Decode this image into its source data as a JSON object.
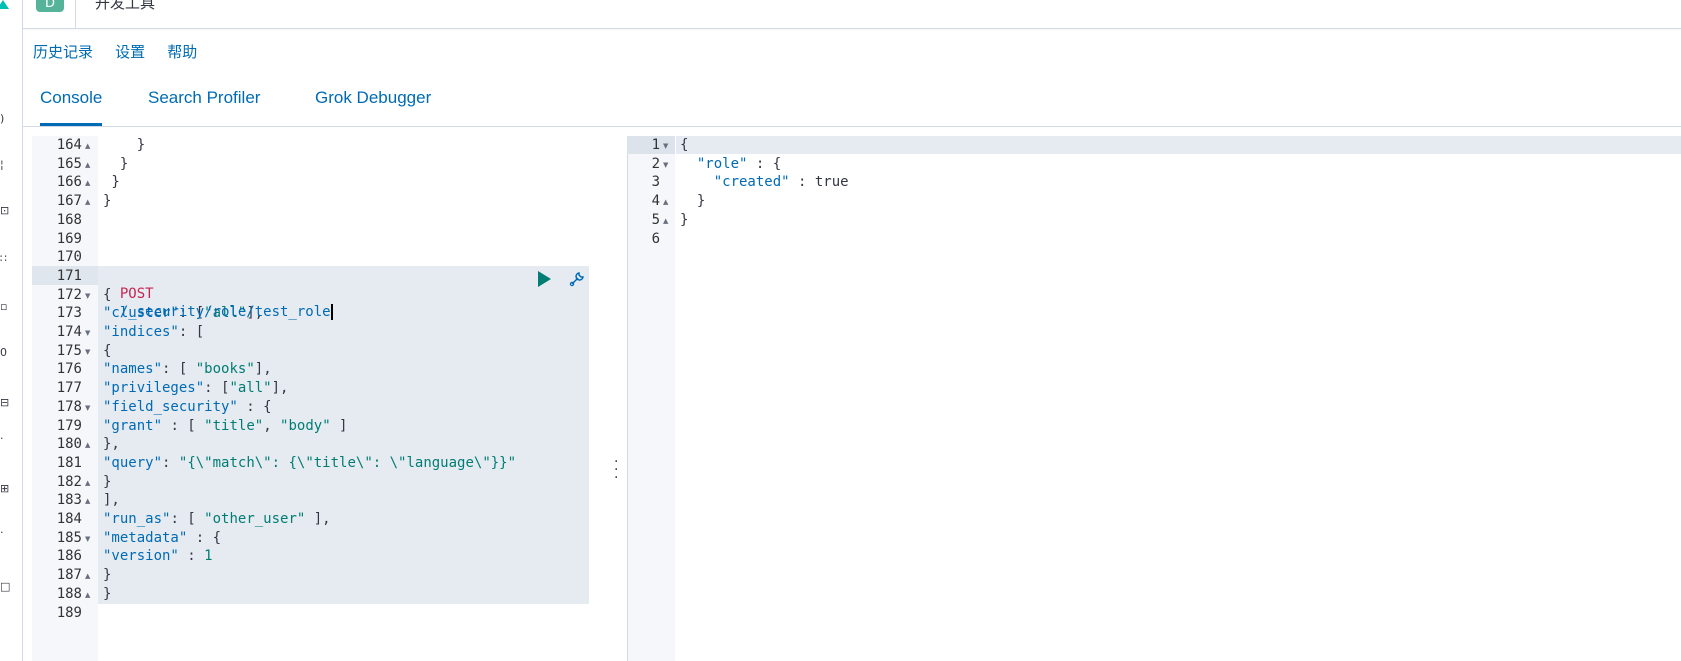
{
  "header": {
    "app_badge": "D",
    "title": "开发工具"
  },
  "menu": {
    "history": "历史记录",
    "settings": "设置",
    "help": "帮助"
  },
  "tabs": [
    {
      "label": "Console",
      "active": true
    },
    {
      "label": "Search Profiler",
      "active": false
    },
    {
      "label": "Grok Debugger",
      "active": false
    }
  ],
  "leftnav": {
    "glyphs": [
      ")",
      "¦",
      "⊡",
      "∷",
      "▫",
      "0",
      "⊟",
      "·",
      "⊞",
      "·",
      "□"
    ]
  },
  "request": {
    "method": "POST",
    "url": "/_security/role/test_role",
    "lines": [
      {
        "n": "164",
        "fold": "up",
        "text": "    }"
      },
      {
        "n": "165",
        "fold": "up",
        "text": "  }"
      },
      {
        "n": "166",
        "fold": "up",
        "text": " }"
      },
      {
        "n": "167",
        "fold": "up",
        "text": "}"
      },
      {
        "n": "168",
        "fold": "",
        "text": ""
      },
      {
        "n": "169",
        "fold": "",
        "text": ""
      },
      {
        "n": "170",
        "fold": "",
        "text": ""
      },
      {
        "n": "171",
        "fold": "",
        "text": ""
      },
      {
        "n": "172",
        "fold": "down",
        "text": "{"
      },
      {
        "n": "173",
        "fold": "",
        "text": "\"cluster\": [\"all\"],"
      },
      {
        "n": "174",
        "fold": "down",
        "text": "\"indices\": ["
      },
      {
        "n": "175",
        "fold": "down",
        "text": "{"
      },
      {
        "n": "176",
        "fold": "",
        "text": "\"names\": [ \"books\"],"
      },
      {
        "n": "177",
        "fold": "",
        "text": "\"privileges\": [\"all\"],"
      },
      {
        "n": "178",
        "fold": "down",
        "text": "\"field_security\" : {"
      },
      {
        "n": "179",
        "fold": "",
        "text": "\"grant\" : [ \"title\", \"body\" ]"
      },
      {
        "n": "180",
        "fold": "up",
        "text": "},"
      },
      {
        "n": "181",
        "fold": "",
        "text": "\"query\": \"{\\\"match\\\": {\\\"title\\\": \\\"language\\\"}}\""
      },
      {
        "n": "182",
        "fold": "up",
        "text": "}"
      },
      {
        "n": "183",
        "fold": "up",
        "text": "],"
      },
      {
        "n": "184",
        "fold": "",
        "text": "\"run_as\": [ \"other_user\" ],"
      },
      {
        "n": "185",
        "fold": "down",
        "text": "\"metadata\" : {"
      },
      {
        "n": "186",
        "fold": "",
        "text": "\"version\" : 1"
      },
      {
        "n": "187",
        "fold": "up",
        "text": "}"
      },
      {
        "n": "188",
        "fold": "up",
        "text": "}"
      },
      {
        "n": "189",
        "fold": "",
        "text": ""
      }
    ]
  },
  "response": {
    "lines": [
      {
        "n": "1",
        "fold": "down",
        "text": "{"
      },
      {
        "n": "2",
        "fold": "down",
        "text": "  \"role\" : {"
      },
      {
        "n": "3",
        "fold": "",
        "text": "    \"created\" : true"
      },
      {
        "n": "4",
        "fold": "up",
        "text": "  }"
      },
      {
        "n": "5",
        "fold": "up",
        "text": "}"
      },
      {
        "n": "6",
        "fold": "",
        "text": ""
      }
    ]
  },
  "colors": {
    "link": "#006bb4",
    "string": "#017d73",
    "method": "#c7254e",
    "bool": "#6b3bd8",
    "badge": "#54b399",
    "highlight": "#e6ebf2"
  },
  "icons": {
    "send": "play-icon",
    "settings": "wrench-icon",
    "resize": "vertical-ellipsis-icon"
  }
}
